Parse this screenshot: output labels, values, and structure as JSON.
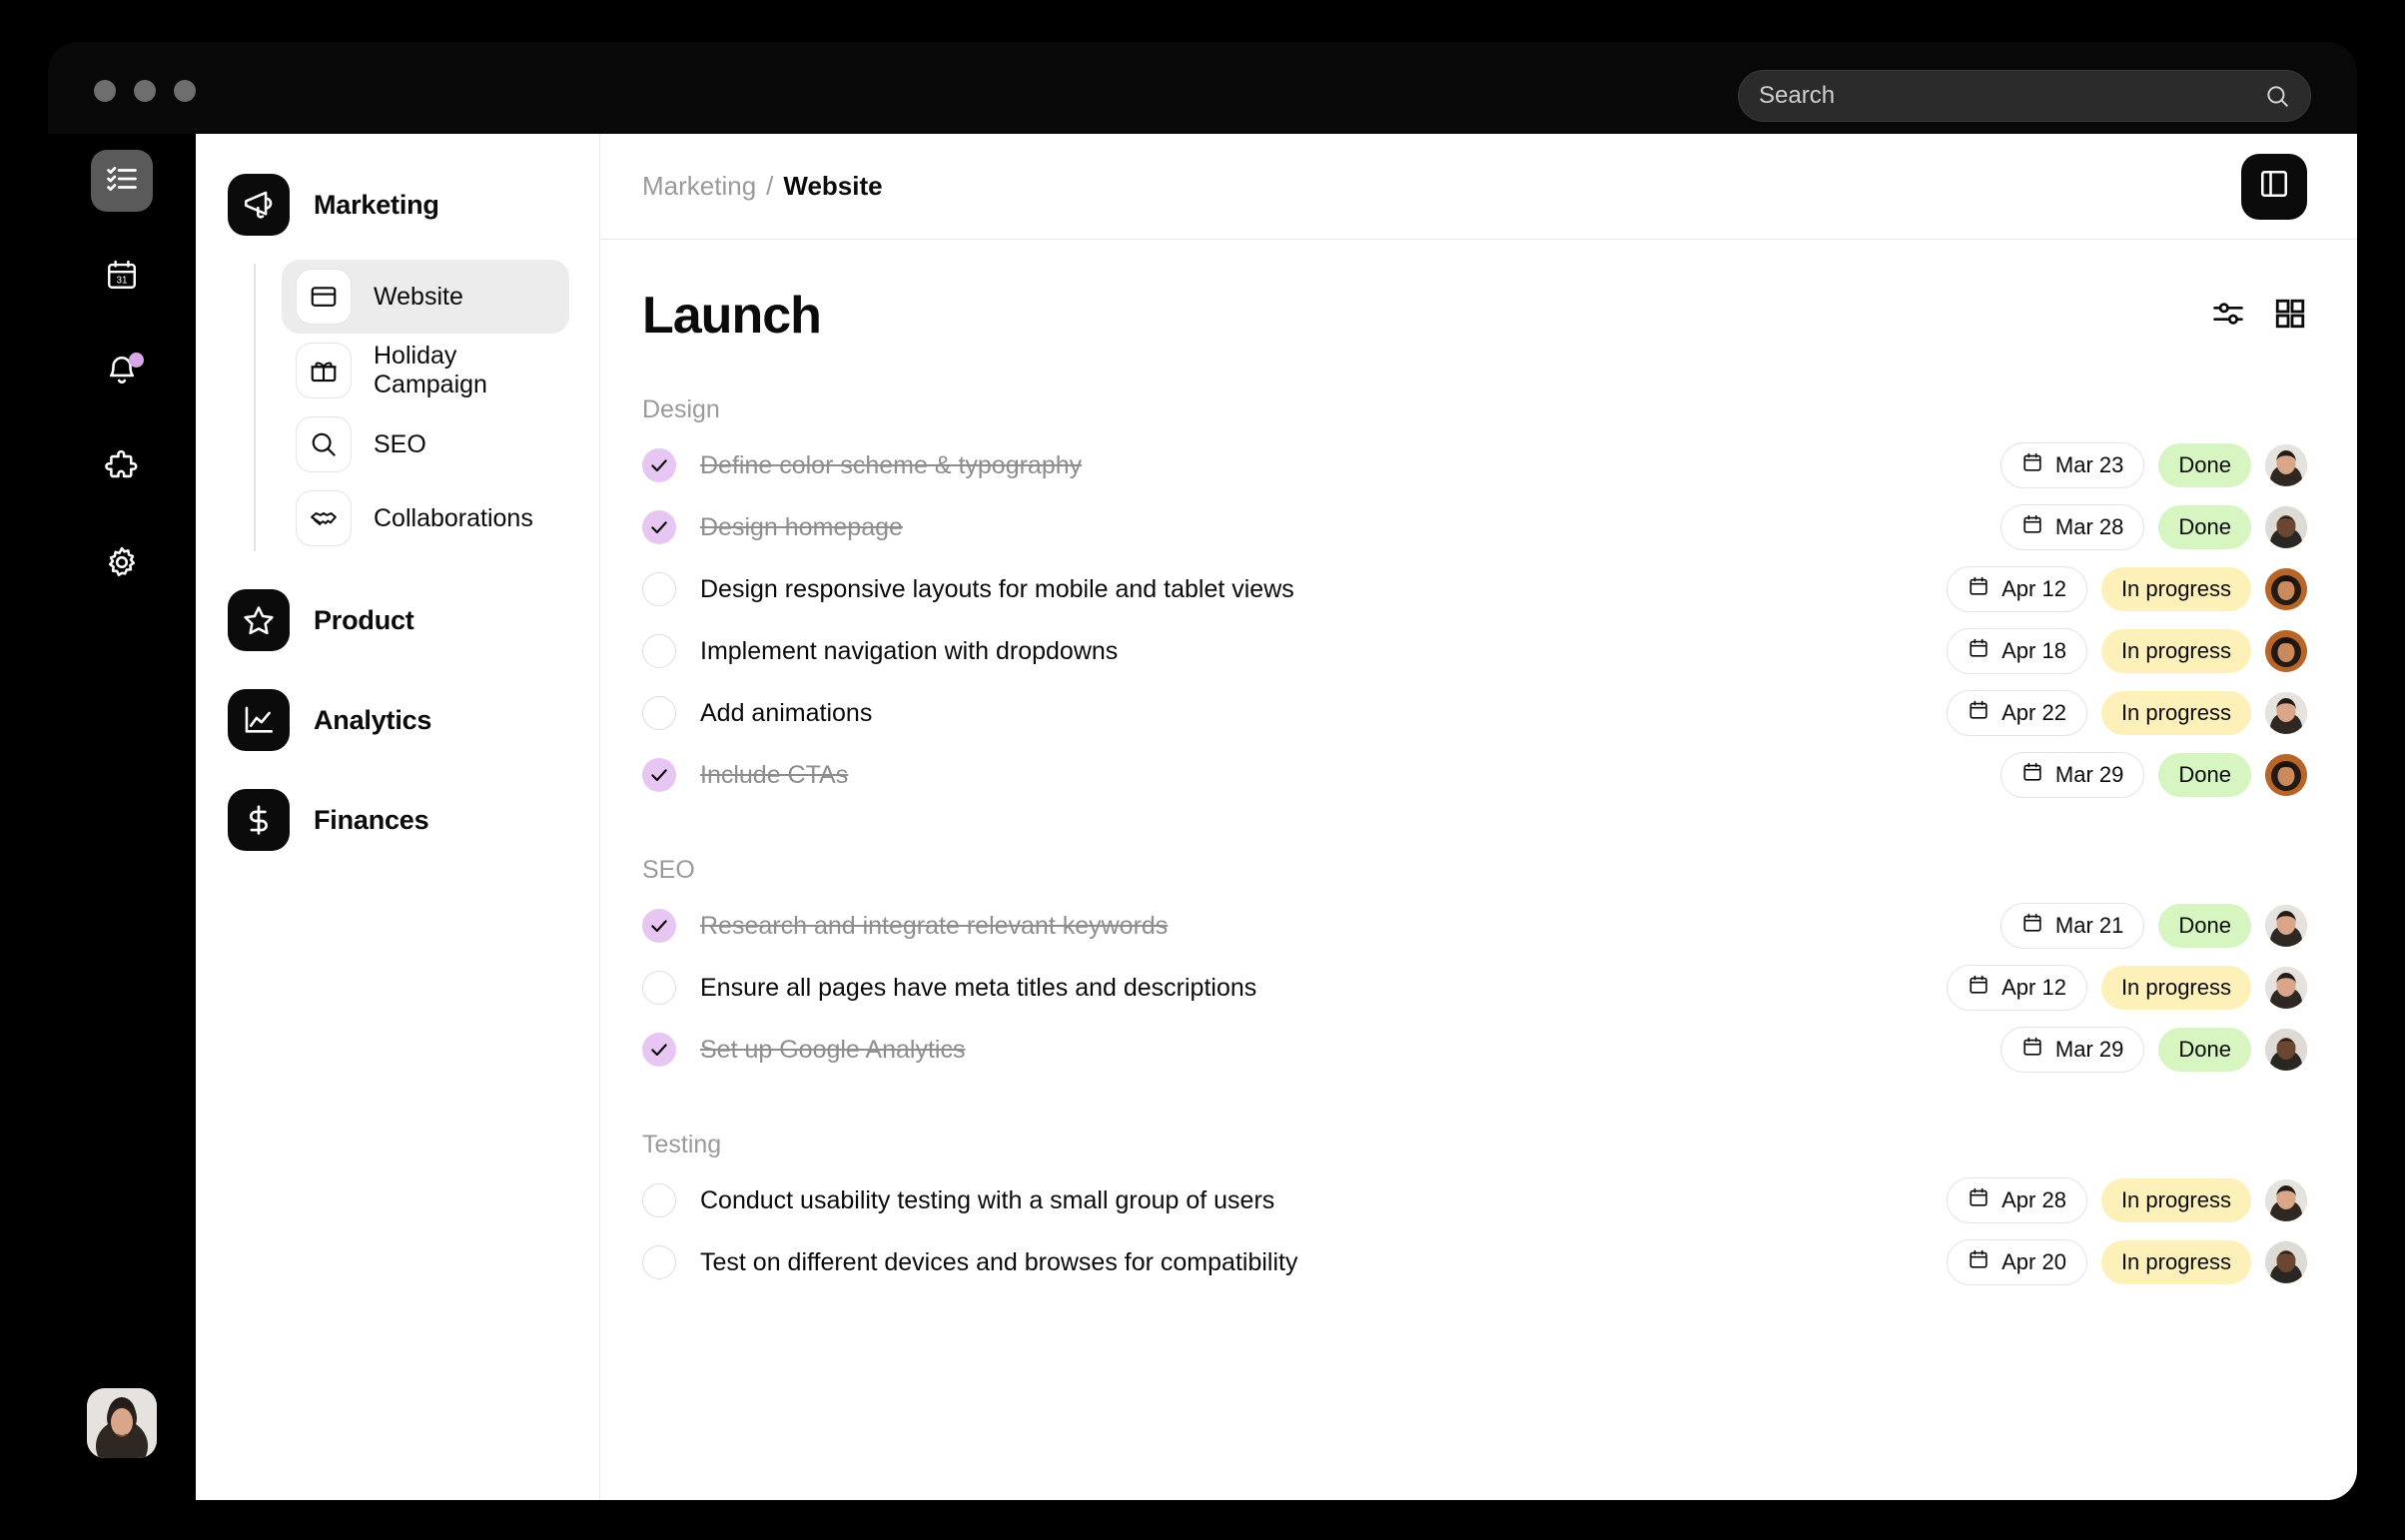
{
  "window": {
    "traffic_lights": [
      "close",
      "minimize",
      "maximize"
    ]
  },
  "search": {
    "placeholder": "Search",
    "value": "",
    "icon": "search-icon"
  },
  "rail": {
    "items": [
      {
        "icon": "checklist-icon",
        "name": "tasks",
        "active": true
      },
      {
        "icon": "calendar-icon",
        "name": "calendar",
        "active": false
      },
      {
        "icon": "bell-icon",
        "name": "notifications",
        "active": false,
        "badge": true
      },
      {
        "icon": "puzzle-icon",
        "name": "integrations",
        "active": false
      },
      {
        "icon": "gear-icon",
        "name": "settings",
        "active": false
      }
    ],
    "badge_color": "#d9a6e8",
    "avatar": "user-avatar"
  },
  "sidebar": {
    "projects": [
      {
        "label": "Marketing",
        "icon": "megaphone-icon",
        "children": [
          {
            "label": "Website",
            "icon": "browser-icon",
            "active": true
          },
          {
            "label": "Holiday Campaign",
            "icon": "gift-icon",
            "active": false
          },
          {
            "label": "SEO",
            "icon": "magnifier-icon",
            "active": false
          },
          {
            "label": "Collaborations",
            "icon": "handshake-icon",
            "active": false
          }
        ]
      },
      {
        "label": "Product",
        "icon": "star-icon",
        "children": []
      },
      {
        "label": "Analytics",
        "icon": "line-chart-icon",
        "children": []
      },
      {
        "label": "Finances",
        "icon": "dollar-icon",
        "children": []
      }
    ]
  },
  "main": {
    "breadcrumb": {
      "parent": "Marketing",
      "separator": "/",
      "current": "Website"
    },
    "panel_toggle_icon": "sidebar-panel-icon",
    "title": "Launch",
    "actions": [
      {
        "icon": "filter-sliders-icon",
        "name": "filter-button"
      },
      {
        "icon": "grid-view-icon",
        "name": "grid-view-button"
      }
    ],
    "sections": [
      {
        "label": "Design",
        "tasks": [
          {
            "text": "Define color scheme & typography",
            "done": true,
            "date": "Mar 23",
            "status": "Done",
            "status_kind": "done",
            "avatar": "avatar-amelia"
          },
          {
            "text": "Design homepage",
            "done": true,
            "date": "Mar 28",
            "status": "Done",
            "status_kind": "done",
            "avatar": "avatar-marcus"
          },
          {
            "text": "Design responsive layouts for mobile and tablet views",
            "done": false,
            "date": "Apr 12",
            "status": "In progress",
            "status_kind": "progress",
            "avatar": "avatar-nina"
          },
          {
            "text": "Implement navigation with dropdowns",
            "done": false,
            "date": "Apr 18",
            "status": "In progress",
            "status_kind": "progress",
            "avatar": "avatar-nina"
          },
          {
            "text": "Add animations",
            "done": false,
            "date": "Apr 22",
            "status": "In progress",
            "status_kind": "progress",
            "avatar": "avatar-amelia"
          },
          {
            "text": "Include CTAs",
            "done": true,
            "date": "Mar 29",
            "status": "Done",
            "status_kind": "done",
            "avatar": "avatar-nina"
          }
        ]
      },
      {
        "label": "SEO",
        "tasks": [
          {
            "text": "Research and integrate relevant keywords",
            "done": true,
            "date": "Mar 21",
            "status": "Done",
            "status_kind": "done",
            "avatar": "avatar-amelia"
          },
          {
            "text": "Ensure all pages have meta titles and descriptions",
            "done": false,
            "date": "Apr 12",
            "status": "In progress",
            "status_kind": "progress",
            "avatar": "avatar-amelia"
          },
          {
            "text": "Set up Google Analytics",
            "done": true,
            "date": "Mar 29",
            "status": "Done",
            "status_kind": "done",
            "avatar": "avatar-marcus"
          }
        ]
      },
      {
        "label": "Testing",
        "tasks": [
          {
            "text": "Conduct usability testing with a small group of users",
            "done": false,
            "date": "Apr 28",
            "status": "In progress",
            "status_kind": "progress",
            "avatar": "avatar-amelia"
          },
          {
            "text": "Test on different devices and browses for compatibility",
            "done": false,
            "date": "Apr 20",
            "status": "In progress",
            "status_kind": "progress",
            "avatar": "avatar-marcus"
          }
        ]
      }
    ]
  },
  "colors": {
    "check_done": "#e7c6f3",
    "status_done_bg": "#d6f5c0",
    "status_progress_bg": "#fdf0b8",
    "rail_bg": "#000000",
    "window_bg": "#090909",
    "accent_badge": "#d9a6e8"
  }
}
